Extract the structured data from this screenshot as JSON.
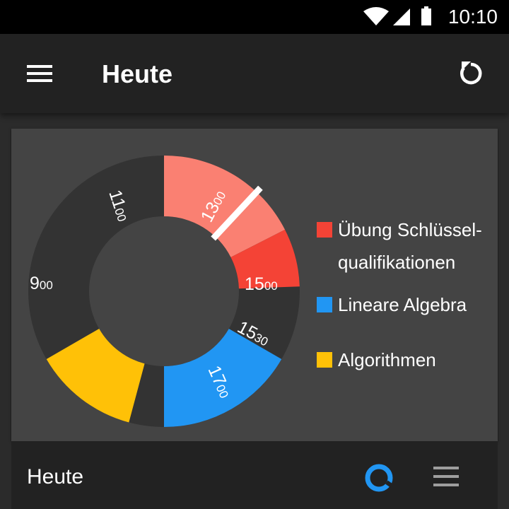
{
  "status_bar": {
    "time": "10:10",
    "icons": [
      "wifi-icon",
      "signal-icon",
      "battery-icon"
    ]
  },
  "app_bar": {
    "title": "Heute",
    "menu_icon": "hamburger-menu-icon",
    "action_icon": "refresh-icon"
  },
  "chart_data": {
    "type": "donut",
    "title": "",
    "slices": [
      {
        "label": "900",
        "hour": "9",
        "minutes": "00",
        "start_deg": 270,
        "end_deg": 333,
        "color": "#FA8072"
      },
      {
        "label": "1100",
        "hour": "11",
        "minutes": "00",
        "start_deg": 333,
        "end_deg": 358,
        "color": "#F44336"
      },
      {
        "label": "1300",
        "hour": "13",
        "minutes": "00",
        "start_deg": 30,
        "end_deg": 90,
        "color": "#2196F3"
      },
      {
        "label": "1530",
        "hour": "15",
        "minutes": "30",
        "start_deg": 105,
        "end_deg": 150,
        "color": "#FFC107"
      }
    ],
    "tick_labels": [
      {
        "hour": "9",
        "minutes": "00"
      },
      {
        "hour": "11",
        "minutes": "00"
      },
      {
        "hour": "13",
        "minutes": "00"
      },
      {
        "hour": "15",
        "minutes": "00"
      },
      {
        "hour": "15",
        "minutes": "30"
      },
      {
        "hour": "17",
        "minutes": "00"
      }
    ],
    "current_time_marker_deg": 313,
    "legend": [
      {
        "name": "Übung Schlüssel-\nqualifikationen",
        "color": "#F44336"
      },
      {
        "name": "Lineare Algebra",
        "color": "#2196F3"
      },
      {
        "name": "Algorithmen",
        "color": "#FFC107"
      }
    ]
  },
  "bottom_bar": {
    "title": "Heute",
    "chart_icon": "donut-chart-icon",
    "list_icon": "list-view-icon"
  },
  "colors": {
    "accent": "#2196F3",
    "background": "#2B2B2B",
    "card": "#444444",
    "bar": "#222222",
    "track": "#333333"
  }
}
